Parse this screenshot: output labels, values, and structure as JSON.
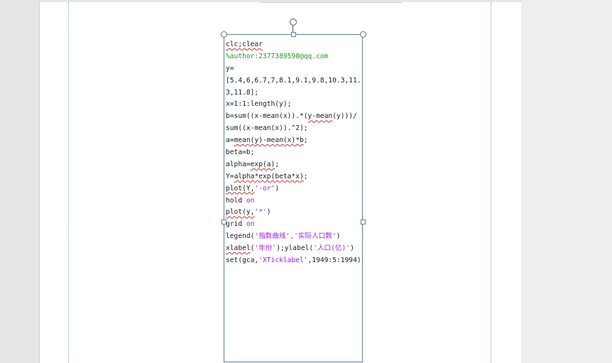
{
  "document": {
    "code_lines": [
      {
        "parts": [
          {
            "text": "clc;clear",
            "style": "squiggle"
          }
        ]
      },
      {
        "parts": [
          {
            "text": "%author:2377389590@qq.com",
            "style": "green"
          }
        ]
      },
      {
        "parts": [
          {
            "text": "y=",
            "style": ""
          }
        ]
      },
      {
        "parts": [
          {
            "text": "[5.4,6,6.7,7,8.1,9.1,9.8,10.3,11.",
            "style": ""
          }
        ]
      },
      {
        "parts": [
          {
            "text": "3,11.8];",
            "style": ""
          }
        ]
      },
      {
        "parts": [
          {
            "text": "x=1:1:length(y);",
            "style": ""
          }
        ]
      },
      {
        "parts": [
          {
            "text": "b=sum((x-mean(x)).*(",
            "style": ""
          },
          {
            "text": "y-mean",
            "style": "squiggle"
          },
          {
            "text": "(y)))/",
            "style": ""
          }
        ]
      },
      {
        "parts": [
          {
            "text": "sum((x-mean(x)).^2);",
            "style": ""
          }
        ]
      },
      {
        "parts": [
          {
            "text": "a=",
            "style": ""
          },
          {
            "text": "mean(y)-mean(x)*b",
            "style": "squiggle"
          },
          {
            "text": ";",
            "style": ""
          }
        ]
      },
      {
        "parts": [
          {
            "text": "beta=b;",
            "style": ""
          }
        ]
      },
      {
        "parts": [
          {
            "text": "alpha=",
            "style": ""
          },
          {
            "text": "exp(a)",
            "style": "squiggle"
          },
          {
            "text": ";",
            "style": ""
          }
        ]
      },
      {
        "parts": [
          {
            "text": "Y=",
            "style": ""
          },
          {
            "text": "alpha*exp(beta*x)",
            "style": "squiggle"
          },
          {
            "text": ";",
            "style": ""
          }
        ]
      },
      {
        "parts": [
          {
            "text": "plot(Y,",
            "style": "squiggle"
          },
          {
            "text": "'-or'",
            "style": "purple"
          },
          {
            "text": ")",
            "style": ""
          }
        ]
      },
      {
        "parts": [
          {
            "text": "hold ",
            "style": ""
          },
          {
            "text": "on",
            "style": "purple"
          }
        ]
      },
      {
        "parts": [
          {
            "text": "plot(y,",
            "style": "squiggle"
          },
          {
            "text": "'*'",
            "style": "purple"
          },
          {
            "text": ")",
            "style": ""
          }
        ]
      },
      {
        "parts": [
          {
            "text": "grid ",
            "style": ""
          },
          {
            "text": "on",
            "style": "purple"
          }
        ]
      },
      {
        "parts": [
          {
            "text": "legend(",
            "style": ""
          },
          {
            "text": "'指数曲线','实际人口数'",
            "style": "purple"
          },
          {
            "text": ")",
            "style": ""
          }
        ]
      },
      {
        "parts": [
          {
            "text": "xlabel",
            "style": "squiggle"
          },
          {
            "text": "(",
            "style": ""
          },
          {
            "text": "'年份'",
            "style": "purple"
          },
          {
            "text": ");ylabel(",
            "style": ""
          },
          {
            "text": "'人口(亿)'",
            "style": "purple"
          },
          {
            "text": ")",
            "style": ""
          }
        ]
      },
      {
        "parts": [
          {
            "text": "set(gca,",
            "style": ""
          },
          {
            "text": "'XTicklabel'",
            "style": "purple"
          },
          {
            "text": ",1949:5:1994)",
            "style": ""
          }
        ]
      }
    ]
  },
  "colors": {
    "comment": "#1e9b1e",
    "string": "#a020f0",
    "spellcheck": "#d23232",
    "selection_border": "#5b7ea8"
  }
}
